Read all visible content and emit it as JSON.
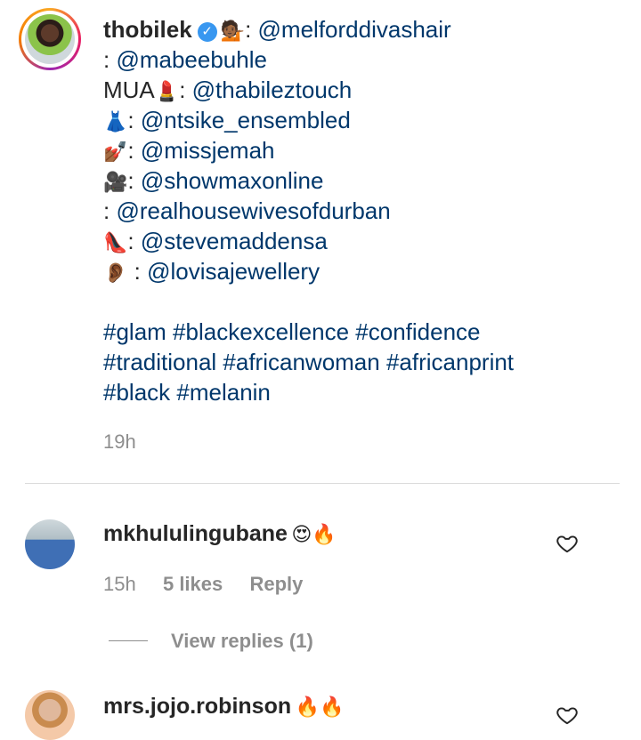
{
  "post": {
    "username": "thobilek",
    "verified_icon": "verified-check-icon",
    "caption_lines": [
      {
        "emoji": "💁🏾",
        "text": ": ",
        "mention": "@melforddivashair",
        "inline": true
      },
      {
        "emoji": "",
        "text": ": ",
        "mention": "@mabeebuhle"
      },
      {
        "emoji": "💄",
        "text_before": "MUA",
        "text": ": ",
        "mention": "@thabileztouch"
      },
      {
        "emoji": "👗",
        "text": ": ",
        "mention": "@ntsike_ensembled"
      },
      {
        "emoji": "💅🏾",
        "text": ": ",
        "mention": "@missjemah"
      },
      {
        "emoji": "🎥",
        "text": ": ",
        "mention": "@showmaxonline"
      },
      {
        "emoji": "",
        "text": ": ",
        "mention": "@realhousewivesofdurban"
      },
      {
        "emoji": "👠",
        "text": ": ",
        "mention": "@stevemaddensa"
      },
      {
        "emoji": "👂🏾",
        "text": " : ",
        "mention": "@lovisajewellery"
      }
    ],
    "hashtag_lines": [
      "#glam #blackexcellence #confidence",
      "#traditional #africanwoman #africanprint",
      "#black #melanin"
    ],
    "time": "19h"
  },
  "comments": [
    {
      "username": "mkhululingubane",
      "emoji": "😍🔥",
      "time": "15h",
      "likes": "5 likes",
      "reply_label": "Reply",
      "view_replies": "View replies (1)",
      "like_icon": "heart-outline-icon"
    },
    {
      "username": "mrs.jojo.robinson",
      "emoji": "🔥🔥",
      "like_icon": "heart-outline-icon"
    }
  ],
  "colors": {
    "text": "#262626",
    "secondary": "#8e8e8e",
    "link": "#00376b",
    "verified": "#3897f0",
    "divider": "#dbdbdb"
  }
}
